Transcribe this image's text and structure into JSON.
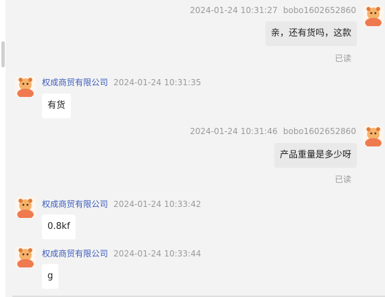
{
  "messages": [
    {
      "side": "out",
      "timestamp": "2024-01-24 10:31:27",
      "sender": "bobo1602652860",
      "text": "亲，还有货吗，这款",
      "status": "已读"
    },
    {
      "side": "in",
      "sender": "权成商贸有限公司",
      "timestamp": "2024-01-24 10:31:35",
      "text": "有货"
    },
    {
      "side": "out",
      "timestamp": "2024-01-24 10:31:46",
      "sender": "bobo1602652860",
      "text": "产品重量是多少呀",
      "status": "已读"
    },
    {
      "side": "in",
      "sender": "权成商贸有限公司",
      "timestamp": "2024-01-24 10:33:42",
      "text": "0.8kf"
    },
    {
      "side": "in",
      "sender": "权成商贸有限公司",
      "timestamp": "2024-01-24 10:33:44",
      "text": "g"
    }
  ],
  "colors": {
    "background": "#f3f3f3",
    "sender_name": "#3b5bbd",
    "meta": "#9a9a9a",
    "incoming_bubble": "#ffffff",
    "outgoing_bubble": "#e9e9e9"
  },
  "icons": {
    "avatar": "cartoon-character-avatar-icon"
  }
}
